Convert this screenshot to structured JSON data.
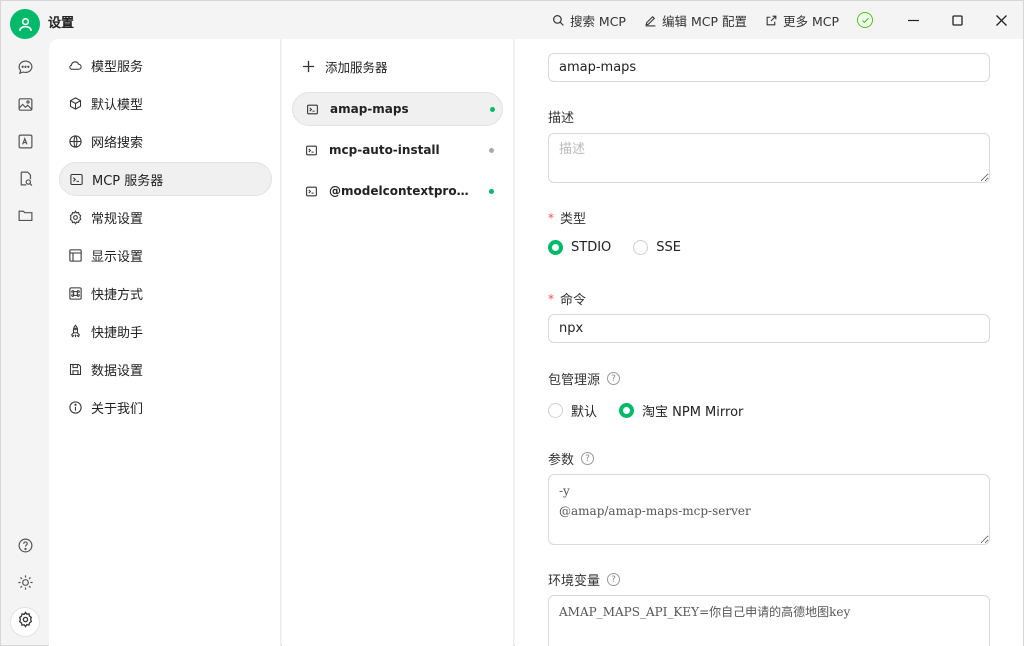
{
  "window": {
    "title": "设置"
  },
  "toolbar": {
    "search_mcp": "搜索 MCP",
    "edit_mcp_config": "编辑 MCP 配置",
    "more_mcp": "更多 MCP"
  },
  "menu": {
    "items": [
      {
        "label": "模型服务",
        "icon": "cloud-icon"
      },
      {
        "label": "默认模型",
        "icon": "cube-icon"
      },
      {
        "label": "网络搜索",
        "icon": "globe-icon"
      },
      {
        "label": "MCP 服务器",
        "icon": "terminal-icon",
        "active": true
      },
      {
        "label": "常规设置",
        "icon": "gear-icon"
      },
      {
        "label": "显示设置",
        "icon": "layout-icon"
      },
      {
        "label": "快捷方式",
        "icon": "command-icon"
      },
      {
        "label": "快捷助手",
        "icon": "rocket-icon"
      },
      {
        "label": "数据设置",
        "icon": "save-icon"
      },
      {
        "label": "关于我们",
        "icon": "info-icon"
      }
    ]
  },
  "servers": {
    "add_label": "添加服务器",
    "items": [
      {
        "name": "amap-maps",
        "status_color": "#00b96b",
        "active": true
      },
      {
        "name": "mcp-auto-install",
        "status_color": "#aaaaaa"
      },
      {
        "name": "@modelcontextprotocol/server-filesystem",
        "status_color": "#00b96b"
      }
    ]
  },
  "form": {
    "name_value": "amap-maps",
    "description_label": "描述",
    "description_placeholder": "描述",
    "type_label": "类型",
    "type_options": [
      "STDIO",
      "SSE"
    ],
    "type_selected": "STDIO",
    "command_label": "命令",
    "command_value": "npx",
    "registry_label": "包管理源",
    "registry_options": [
      "默认",
      "淘宝 NPM Mirror"
    ],
    "registry_selected": "淘宝 NPM Mirror",
    "args_label": "参数",
    "args_value": "-y\n@amap/amap-maps-mcp-server",
    "env_label": "环境变量",
    "env_value": "AMAP_MAPS_API_KEY=你自己申请的高德地图key"
  },
  "colors": {
    "accent": "#00b96b",
    "required": "#ff4d4f"
  }
}
